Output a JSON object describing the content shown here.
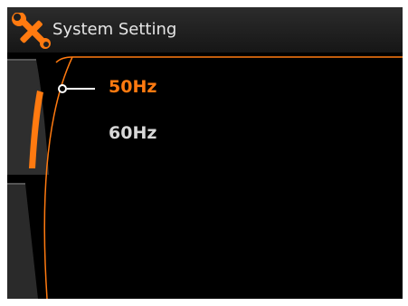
{
  "header": {
    "title": "System Setting",
    "icon": "wrench-screwdriver-icon"
  },
  "menu": {
    "items": [
      {
        "label": "50Hz",
        "selected": true
      },
      {
        "label": "60Hz",
        "selected": false
      }
    ]
  },
  "colors": {
    "accent": "#ff7a10",
    "background": "#000000",
    "text": "#d8d8d8"
  }
}
